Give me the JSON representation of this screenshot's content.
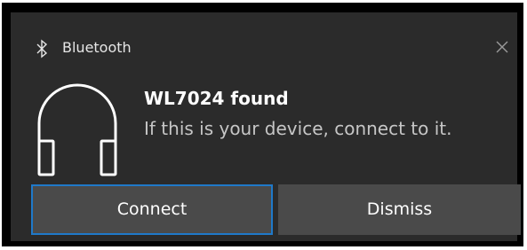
{
  "notification": {
    "app_name": "Bluetooth",
    "app_icon": "bluetooth-icon",
    "close_icon": "close-icon",
    "device_icon": "headphones-icon",
    "title": "WL7024 found",
    "message": "If this is your device, connect to it."
  },
  "actions": {
    "connect_label": "Connect",
    "dismiss_label": "Dismiss"
  },
  "colors": {
    "background": "#2b2b2b",
    "button": "#4a4a4a",
    "accent_border": "#1f79c9"
  }
}
